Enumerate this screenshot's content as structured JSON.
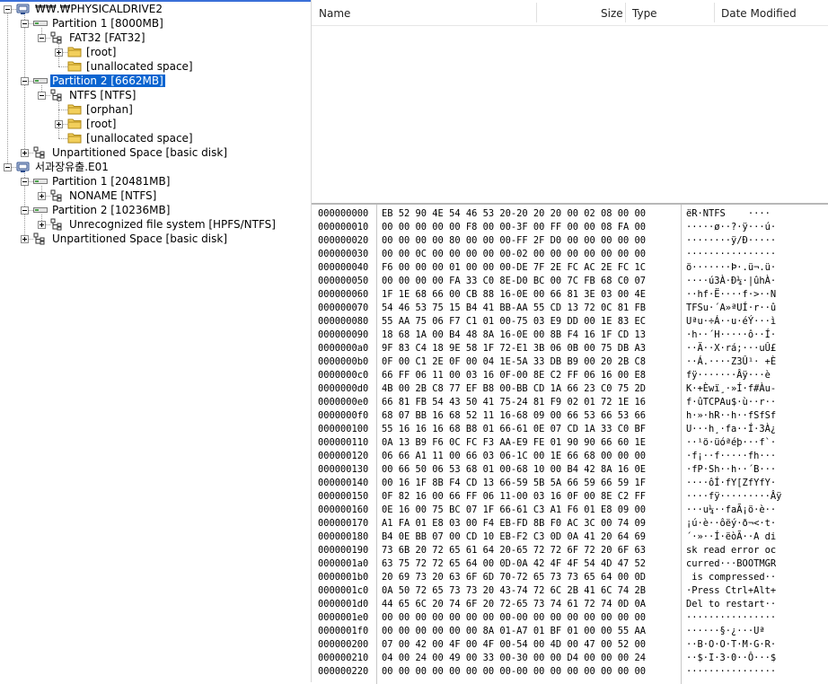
{
  "tree": {
    "nodes": [
      {
        "label": "₩₩.₩PHYSICALDRIVE2",
        "depth": 0,
        "expander": "minus",
        "icon": "drive-icon"
      },
      {
        "label": "Partition 1 [8000MB]",
        "depth": 1,
        "expander": "minus",
        "icon": "partition-icon"
      },
      {
        "label": "FAT32 [FAT32]",
        "depth": 2,
        "expander": "minus",
        "icon": "filesystem-icon"
      },
      {
        "label": "[root]",
        "depth": 3,
        "expander": "plus",
        "icon": "folder-icon"
      },
      {
        "label": "[unallocated space]",
        "depth": 3,
        "expander": "none",
        "icon": "folder-icon"
      },
      {
        "label": "Partition 2 [6662MB]",
        "depth": 1,
        "expander": "minus",
        "icon": "partition-icon",
        "selected": true
      },
      {
        "label": "NTFS [NTFS]",
        "depth": 2,
        "expander": "minus",
        "icon": "filesystem-icon"
      },
      {
        "label": "[orphan]",
        "depth": 3,
        "expander": "none",
        "icon": "folder-icon"
      },
      {
        "label": "[root]",
        "depth": 3,
        "expander": "plus",
        "icon": "folder-icon"
      },
      {
        "label": "[unallocated space]",
        "depth": 3,
        "expander": "none",
        "icon": "folder-icon"
      },
      {
        "label": "Unpartitioned Space [basic disk]",
        "depth": 1,
        "expander": "plus",
        "icon": "filesystem-icon"
      },
      {
        "label": "서과장유출.E01",
        "depth": 0,
        "expander": "minus",
        "icon": "drive-icon"
      },
      {
        "label": "Partition 1 [20481MB]",
        "depth": 1,
        "expander": "minus",
        "icon": "partition-icon"
      },
      {
        "label": "NONAME [NTFS]",
        "depth": 2,
        "expander": "plus",
        "icon": "filesystem-icon"
      },
      {
        "label": "Partition 2 [10236MB]",
        "depth": 1,
        "expander": "minus",
        "icon": "partition-icon"
      },
      {
        "label": "Unrecognized file system [HPFS/NTFS]",
        "depth": 2,
        "expander": "plus",
        "icon": "filesystem-icon"
      },
      {
        "label": "Unpartitioned Space [basic disk]",
        "depth": 1,
        "expander": "plus",
        "icon": "filesystem-icon"
      }
    ]
  },
  "file_list": {
    "columns": {
      "name": "Name",
      "size": "Size",
      "type": "Type",
      "date_modified": "Date Modified"
    }
  },
  "hex_view": {
    "rows": [
      {
        "offset": "000000000",
        "bytes": "EB 52 90 4E 54 46 53 20-20 20 20 00 02 08 00 00",
        "ascii": "ëR·NTFS    ····"
      },
      {
        "offset": "000000010",
        "bytes": "00 00 00 00 00 F8 00 00-3F 00 FF 00 00 08 FA 00",
        "ascii": "·····ø··?·ÿ···ú·"
      },
      {
        "offset": "000000020",
        "bytes": "00 00 00 00 80 00 00 00-FF 2F D0 00 00 00 00 00",
        "ascii": "········ÿ/Ð·····"
      },
      {
        "offset": "000000030",
        "bytes": "00 00 0C 00 00 00 00 00-02 00 00 00 00 00 00 00",
        "ascii": "················"
      },
      {
        "offset": "000000040",
        "bytes": "F6 00 00 00 01 00 00 00-DE 7F 2E FC AC 2E FC 1C",
        "ascii": "ö·······Þ·.ü¬.ü·"
      },
      {
        "offset": "000000050",
        "bytes": "00 00 00 00 FA 33 C0 8E-D0 BC 00 7C FB 68 C0 07",
        "ascii": "····ú3À·Ð¼·|ûhÀ·"
      },
      {
        "offset": "000000060",
        "bytes": "1F 1E 68 66 00 CB 88 16-0E 00 66 81 3E 03 00 4E",
        "ascii": "··hf·Ë····f·>··N"
      },
      {
        "offset": "000000070",
        "bytes": "54 46 53 75 15 B4 41 BB-AA 55 CD 13 72 0C 81 FB",
        "ascii": "TFSu·´A»ªUÍ·r··û"
      },
      {
        "offset": "000000080",
        "bytes": "55 AA 75 06 F7 C1 01 00-75 03 E9 DD 00 1E 83 EC",
        "ascii": "Uªu·÷Á··u·éÝ···ì"
      },
      {
        "offset": "000000090",
        "bytes": "18 68 1A 00 B4 48 8A 16-0E 00 8B F4 16 1F CD 13",
        "ascii": "·h··´H·····ô··Í·"
      },
      {
        "offset": "0000000a0",
        "bytes": "9F 83 C4 18 9E 58 1F 72-E1 3B 06 0B 00 75 DB A3",
        "ascii": "··Ä··X·rá;···uÛ£"
      },
      {
        "offset": "0000000b0",
        "bytes": "0F 00 C1 2E 0F 00 04 1E-5A 33 DB B9 00 20 2B C8",
        "ascii": "··Á.····Z3Û¹· +È"
      },
      {
        "offset": "0000000c0",
        "bytes": "66 FF 06 11 00 03 16 0F-00 8E C2 FF 06 16 00 E8",
        "ascii": "fÿ·······Âÿ···è"
      },
      {
        "offset": "0000000d0",
        "bytes": "4B 00 2B C8 77 EF B8 00-BB CD 1A 66 23 C0 75 2D",
        "ascii": "K·+Èwï¸·»Í·f#Àu-"
      },
      {
        "offset": "0000000e0",
        "bytes": "66 81 FB 54 43 50 41 75-24 81 F9 02 01 72 1E 16",
        "ascii": "f·ûTCPAu$·ù··r··"
      },
      {
        "offset": "0000000f0",
        "bytes": "68 07 BB 16 68 52 11 16-68 09 00 66 53 66 53 66",
        "ascii": "h·»·hR··h··fSfSf"
      },
      {
        "offset": "000000100",
        "bytes": "55 16 16 16 68 B8 01 66-61 0E 07 CD 1A 33 C0 BF",
        "ascii": "U···h¸·fa··Í·3À¿"
      },
      {
        "offset": "000000110",
        "bytes": "0A 13 B9 F6 0C FC F3 AA-E9 FE 01 90 90 66 60 1E",
        "ascii": "··¹ö·üóªéþ···f`·"
      },
      {
        "offset": "000000120",
        "bytes": "06 66 A1 11 00 66 03 06-1C 00 1E 66 68 00 00 00",
        "ascii": "·f¡··f·····fh···"
      },
      {
        "offset": "000000130",
        "bytes": "00 66 50 06 53 68 01 00-68 10 00 B4 42 8A 16 0E",
        "ascii": "·fP·Sh··h··´B···"
      },
      {
        "offset": "000000140",
        "bytes": "00 16 1F 8B F4 CD 13 66-59 5B 5A 66 59 66 59 1F",
        "ascii": "····ôÍ·fY[ZfYfY·"
      },
      {
        "offset": "000000150",
        "bytes": "0F 82 16 00 66 FF 06 11-00 03 16 0F 00 8E C2 FF",
        "ascii": "····fÿ·········Âÿ"
      },
      {
        "offset": "000000160",
        "bytes": "0E 16 00 75 BC 07 1F 66-61 C3 A1 F6 01 E8 09 00",
        "ascii": "···u¼··faÃ¡ö·è··"
      },
      {
        "offset": "000000170",
        "bytes": "A1 FA 01 E8 03 00 F4 EB-FD 8B F0 AC 3C 00 74 09",
        "ascii": "¡ú·è··ôëý·ð¬<·t·"
      },
      {
        "offset": "000000180",
        "bytes": "B4 0E BB 07 00 CD 10 EB-F2 C3 0D 0A 41 20 64 69",
        "ascii": "´·»··Í·ëòÃ··A di"
      },
      {
        "offset": "000000190",
        "bytes": "73 6B 20 72 65 61 64 20-65 72 72 6F 72 20 6F 63",
        "ascii": "sk read error oc"
      },
      {
        "offset": "0000001a0",
        "bytes": "63 75 72 72 65 64 00 0D-0A 42 4F 4F 54 4D 47 52",
        "ascii": "curred···BOOTMGR"
      },
      {
        "offset": "0000001b0",
        "bytes": "20 69 73 20 63 6F 6D 70-72 65 73 73 65 64 00 0D",
        "ascii": " is compressed··"
      },
      {
        "offset": "0000001c0",
        "bytes": "0A 50 72 65 73 73 20 43-74 72 6C 2B 41 6C 74 2B",
        "ascii": "·Press Ctrl+Alt+"
      },
      {
        "offset": "0000001d0",
        "bytes": "44 65 6C 20 74 6F 20 72-65 73 74 61 72 74 0D 0A",
        "ascii": "Del to restart··"
      },
      {
        "offset": "0000001e0",
        "bytes": "00 00 00 00 00 00 00 00-00 00 00 00 00 00 00 00",
        "ascii": "················"
      },
      {
        "offset": "0000001f0",
        "bytes": "00 00 00 00 00 00 8A 01-A7 01 BF 01 00 00 55 AA",
        "ascii": "······§·¿···Uª"
      },
      {
        "offset": "000000200",
        "bytes": "07 00 42 00 4F 00 4F 00-54 00 4D 00 47 00 52 00",
        "ascii": "··B·O·O·T·M·G·R·"
      },
      {
        "offset": "000000210",
        "bytes": "04 00 24 00 49 00 33 00-30 00 00 D4 00 00 00 24",
        "ascii": "··$·I·3·0··Ô···$"
      },
      {
        "offset": "000000220",
        "bytes": "00 00 00 00 00 00 00 00-00 00 00 00 00 00 00 00",
        "ascii": "················"
      }
    ]
  },
  "colors": {
    "selection": "#0a64d0",
    "folder": "#f2cf5b",
    "accent": "#3a6fd8"
  }
}
